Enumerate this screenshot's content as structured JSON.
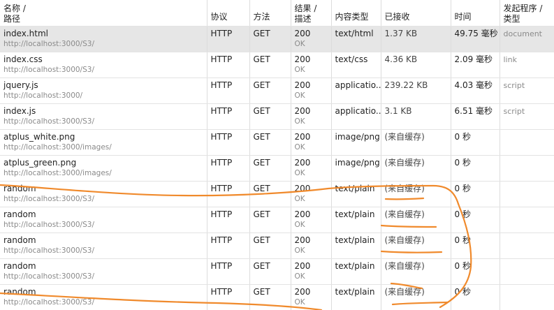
{
  "columns": {
    "name_line1": "名称 /",
    "name_line2": "路径",
    "protocol": "协议",
    "method": "方法",
    "result_line1": "结果 /",
    "result_line2": "描述",
    "content_type": "内容类型",
    "received": "已接收",
    "time": "时间",
    "initiator_line1": "发起程序 /",
    "initiator_line2": "类型"
  },
  "rows": [
    {
      "name": "index.html",
      "path": "http://localhost:3000/S3/",
      "protocol": "HTTP",
      "method": "GET",
      "status": "200",
      "status_text": "OK",
      "type": "text/html",
      "received": "1.37 KB",
      "time": "49.75 毫秒",
      "initiator": "document",
      "selected": true
    },
    {
      "name": "index.css",
      "path": "http://localhost:3000/S3/",
      "protocol": "HTTP",
      "method": "GET",
      "status": "200",
      "status_text": "OK",
      "type": "text/css",
      "received": "4.36 KB",
      "time": "2.09 毫秒",
      "initiator": "link"
    },
    {
      "name": "jquery.js",
      "path": "http://localhost:3000/",
      "protocol": "HTTP",
      "method": "GET",
      "status": "200",
      "status_text": "OK",
      "type": "applicatio...",
      "received": "239.22 KB",
      "time": "4.03 毫秒",
      "initiator": "script"
    },
    {
      "name": "index.js",
      "path": "http://localhost:3000/S3/",
      "protocol": "HTTP",
      "method": "GET",
      "status": "200",
      "status_text": "OK",
      "type": "applicatio...",
      "received": "3.1 KB",
      "time": "6.51 毫秒",
      "initiator": "script"
    },
    {
      "name": "atplus_white.png",
      "path": "http://localhost:3000/images/",
      "protocol": "HTTP",
      "method": "GET",
      "status": "200",
      "status_text": "OK",
      "type": "image/png",
      "received": "(来自缓存)",
      "time": "0 秒",
      "initiator": ""
    },
    {
      "name": "atplus_green.png",
      "path": "http://localhost:3000/images/",
      "protocol": "HTTP",
      "method": "GET",
      "status": "200",
      "status_text": "OK",
      "type": "image/png",
      "received": "(来自缓存)",
      "time": "0 秒",
      "initiator": ""
    },
    {
      "name": "random",
      "path": "http://localhost:3000/S3/",
      "protocol": "HTTP",
      "method": "GET",
      "status": "200",
      "status_text": "OK",
      "type": "text/plain",
      "received": "(来自缓存)",
      "time": "0 秒",
      "initiator": ""
    },
    {
      "name": "random",
      "path": "http://localhost:3000/S3/",
      "protocol": "HTTP",
      "method": "GET",
      "status": "200",
      "status_text": "OK",
      "type": "text/plain",
      "received": "(来自缓存)",
      "time": "0 秒",
      "initiator": ""
    },
    {
      "name": "random",
      "path": "http://localhost:3000/S3/",
      "protocol": "HTTP",
      "method": "GET",
      "status": "200",
      "status_text": "OK",
      "type": "text/plain",
      "received": "(来自缓存)",
      "time": "0 秒",
      "initiator": ""
    },
    {
      "name": "random",
      "path": "http://localhost:3000/S3/",
      "protocol": "HTTP",
      "method": "GET",
      "status": "200",
      "status_text": "OK",
      "type": "text/plain",
      "received": "(来自缓存)",
      "time": "0 秒",
      "initiator": ""
    },
    {
      "name": "random",
      "path": "http://localhost:3000/S3/",
      "protocol": "HTTP",
      "method": "GET",
      "status": "200",
      "status_text": "OK",
      "type": "text/plain",
      "received": "(来自缓存)",
      "time": "0 秒",
      "initiator": ""
    }
  ],
  "colors": {
    "selected_row": "#e6e6e6",
    "annotation": "#f08a2c",
    "muted_text": "#8a8a8a"
  }
}
